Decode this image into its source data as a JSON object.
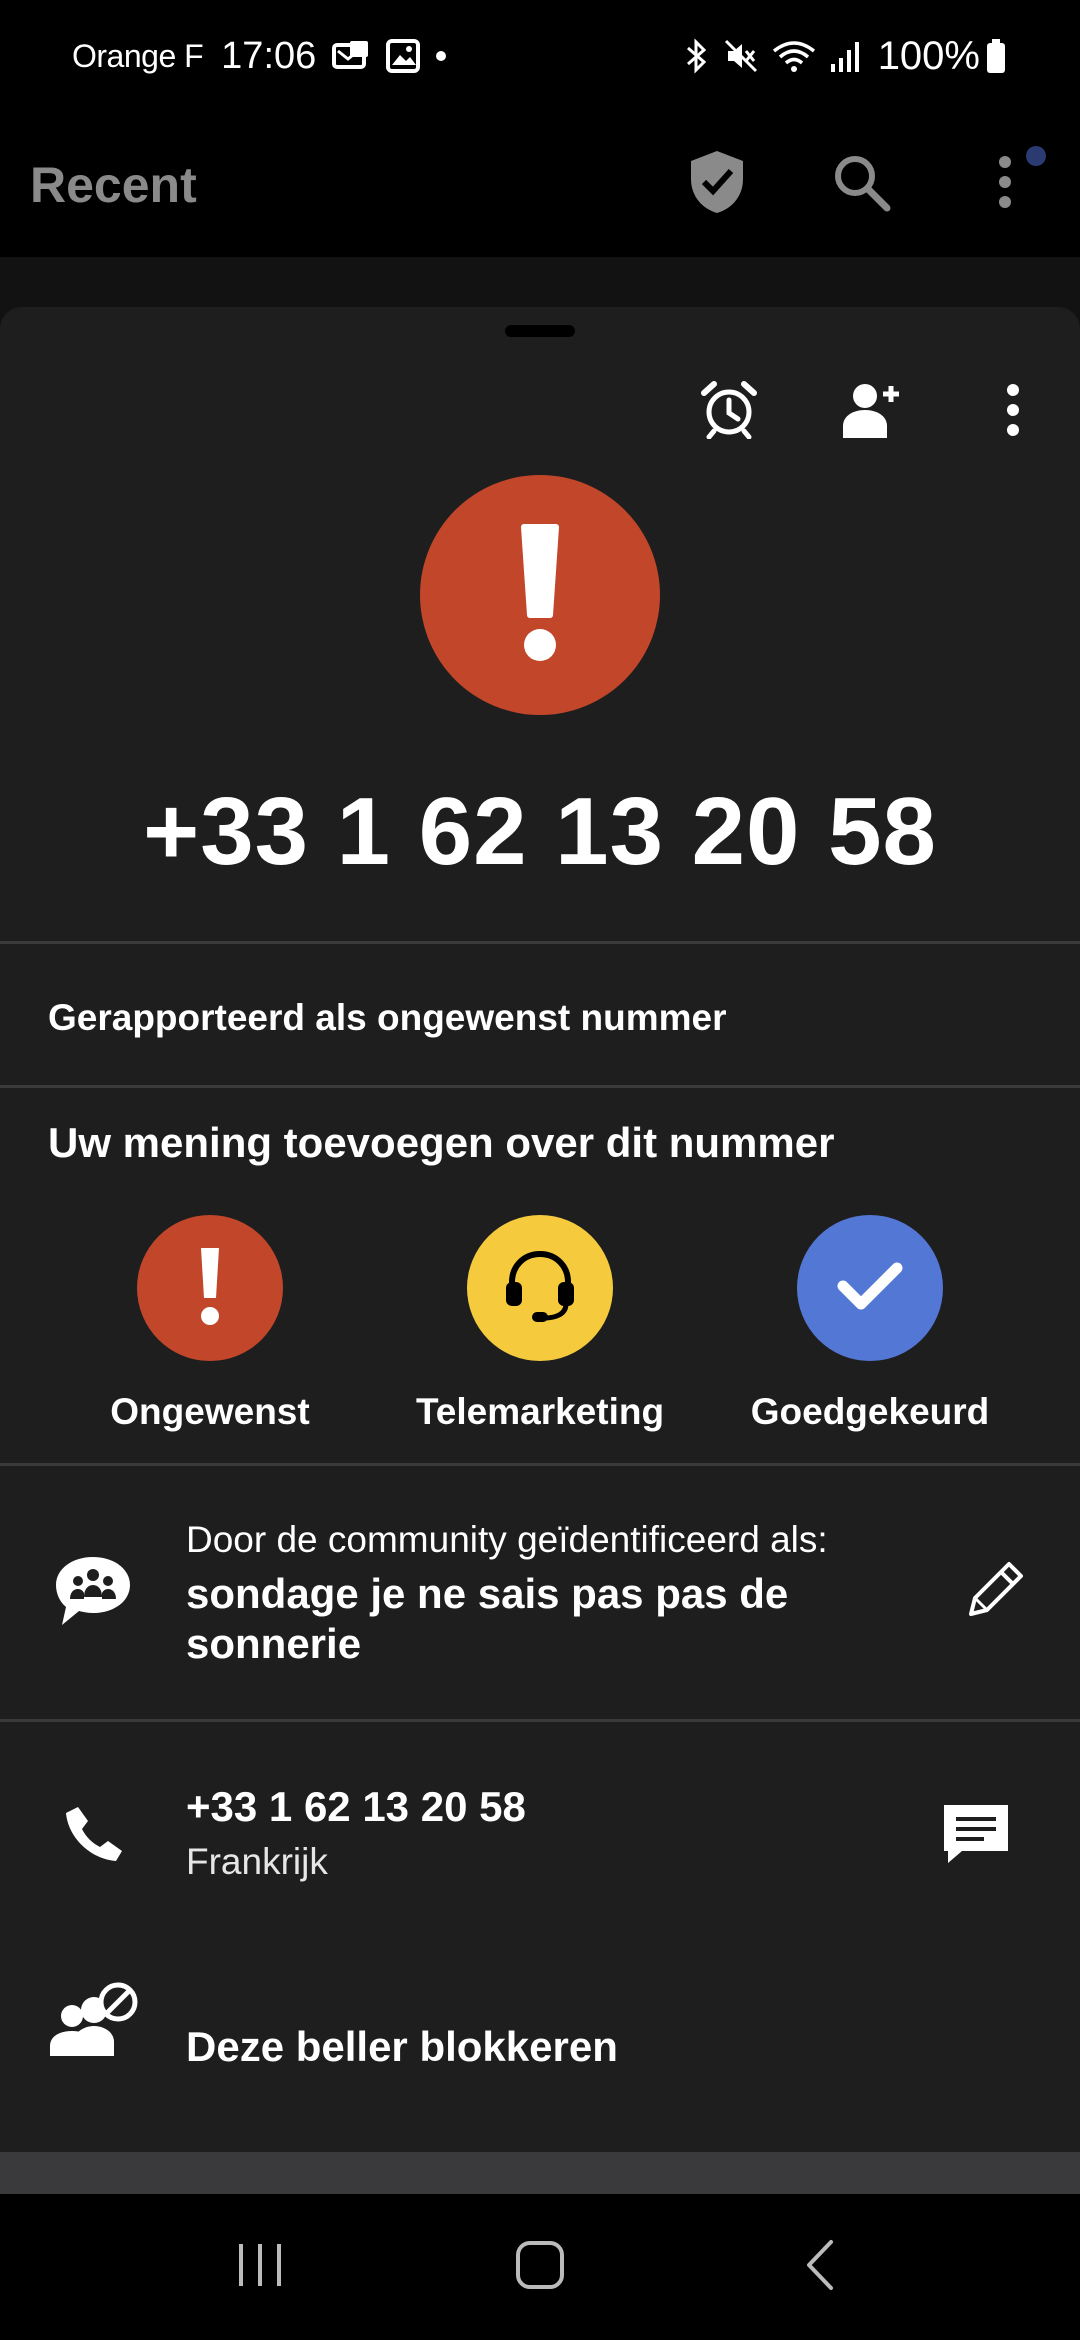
{
  "status_bar": {
    "carrier": "Orange F",
    "time": "17:06",
    "battery": "100%"
  },
  "app_bar": {
    "title": "Recent"
  },
  "caller": {
    "number": "+33 1 62 13 20 58",
    "alert_color": "#c1462a"
  },
  "reported_text": "Gerapporteerd als ongewenst nummer",
  "opinion": {
    "title": "Uw mening toevoegen over dit nummer",
    "options": [
      {
        "label": "Ongewenst",
        "color": "#c1462a",
        "icon": "exclamation-icon"
      },
      {
        "label": "Telemarketing",
        "color": "#f5cb3d",
        "icon": "headset-icon"
      },
      {
        "label": "Goedgekeurd",
        "color": "#5277d4",
        "icon": "check-icon"
      }
    ]
  },
  "community": {
    "caption": "Door de community geïdentificeerd als:",
    "value": "sondage je ne sais pas pas de sonnerie"
  },
  "phone_row": {
    "number": "+33 1 62 13 20 58",
    "country": "Frankrijk"
  },
  "block": {
    "label": "Deze beller blokkeren"
  }
}
